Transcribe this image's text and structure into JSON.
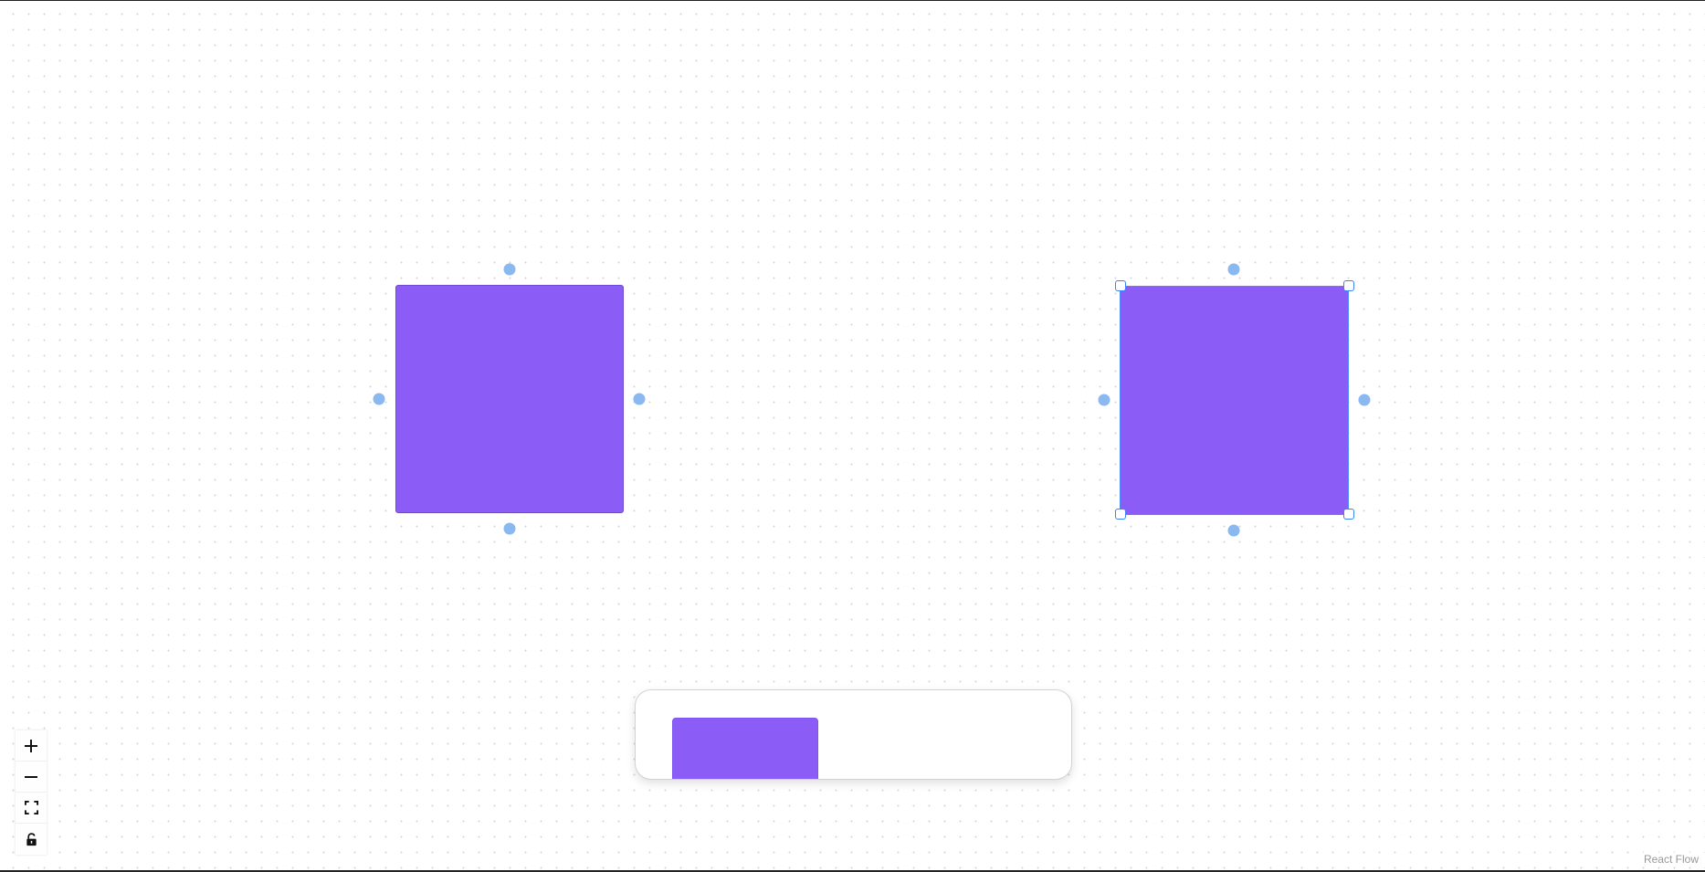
{
  "canvas": {
    "background_color": "#ffffff",
    "dot_color": "#d6d6d6"
  },
  "nodes": [
    {
      "id": "node-1",
      "color": "#8b5cf6",
      "selected": false
    },
    {
      "id": "node-2",
      "color": "#8b5cf6",
      "selected": true
    }
  ],
  "colors": {
    "node_fill": "#8b5cf6",
    "handle": "#8ab9f1",
    "selection": "#3b82f6"
  },
  "palette": {
    "item_color": "#8b5cf6"
  },
  "controls": [
    {
      "name": "zoom-in",
      "icon": "plus-icon"
    },
    {
      "name": "zoom-out",
      "icon": "minus-icon"
    },
    {
      "name": "fit-view",
      "icon": "fit-view-icon"
    },
    {
      "name": "toggle-interactivity",
      "icon": "lock-icon"
    }
  ],
  "attribution": {
    "label": "React Flow"
  }
}
